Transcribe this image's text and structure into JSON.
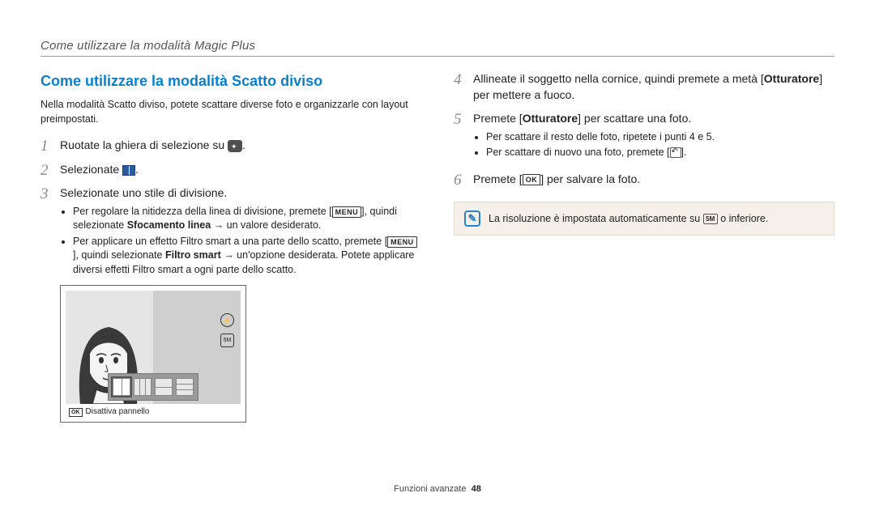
{
  "header": {
    "title": "Come utilizzare la modalità Magic Plus"
  },
  "left": {
    "heading": "Come utilizzare la modalità Scatto diviso",
    "intro": "Nella modalità Scatto diviso, potete scattare diverse foto e organizzarle con layout preimpostati.",
    "step1_pre": "Ruotate la ghiera di selezione su ",
    "step1_post": ".",
    "step2_pre": "Selezionate ",
    "step2_post": ".",
    "step3": "Selezionate uno stile di divisione.",
    "bullet3a_pre": "Per regolare la nitidezza della linea di divisione, premete [",
    "bullet3a_mid": "], quindi selezionate ",
    "bullet3a_bold": "Sfocamento linea",
    "bullet3a_post": " → un valore desiderato.",
    "bullet3b_pre": "Per applicare un effetto Filtro smart a una parte dello scatto, premete [",
    "bullet3b_mid": "], quindi selezionate ",
    "bullet3b_bold": "Filtro smart",
    "bullet3b_post": " → un'opzione desiderata. Potete applicare diversi effetti Filtro smart a ogni parte dello scatto.",
    "preview_caption": "Disattiva pannello"
  },
  "right": {
    "step4_pre": "Allineate il soggetto nella cornice, quindi premete a metà [",
    "step4_bold": "Otturatore",
    "step4_post": "] per mettere a fuoco.",
    "step5_pre": "Premete [",
    "step5_bold": "Otturatore",
    "step5_post": "] per scattare una foto.",
    "bullet5a": "Per scattare il resto delle foto, ripetete i punti 4 e 5.",
    "bullet5b_pre": "Per scattare di nuovo una foto, premete [",
    "bullet5b_post": "].",
    "step6_pre": "Premete [",
    "step6_post": "] per salvare la foto.",
    "note_pre": "La risoluzione è impostata automaticamente su ",
    "note_post": " o inferiore.",
    "icon_5m_label": "5M"
  },
  "footer": {
    "section": "Funzioni avanzate",
    "page": "48"
  }
}
